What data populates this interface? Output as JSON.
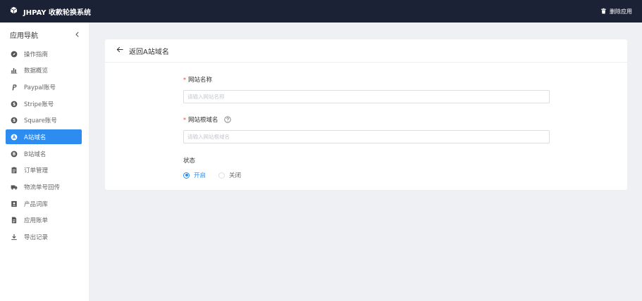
{
  "header": {
    "title": "JHPAY 收款轮换系统",
    "uninstall_label": "删除应用"
  },
  "sidebar": {
    "title": "应用导航",
    "items": [
      {
        "label": "操作指南",
        "icon": "compass-icon",
        "active": false
      },
      {
        "label": "数据概览",
        "icon": "bar-chart-icon",
        "active": false
      },
      {
        "label": "Paypal账号",
        "icon": "paypal-icon",
        "active": false
      },
      {
        "label": "Stripe账号",
        "icon": "dollar-circle-icon",
        "active": false
      },
      {
        "label": "Square账号",
        "icon": "dollar-circle-icon",
        "active": false
      },
      {
        "label": "A站域名",
        "icon": "letter-a-circle-icon",
        "active": true
      },
      {
        "label": "B站域名",
        "icon": "letter-b-circle-icon",
        "active": false
      },
      {
        "label": "订单管理",
        "icon": "clipboard-icon",
        "active": false
      },
      {
        "label": "物流单号回传",
        "icon": "truck-icon",
        "active": false
      },
      {
        "label": "产品词库",
        "icon": "contact-book-icon",
        "active": false
      },
      {
        "label": "应用账单",
        "icon": "document-icon",
        "active": false
      },
      {
        "label": "导出记录",
        "icon": "download-icon",
        "active": false
      }
    ]
  },
  "card": {
    "back_label": "返回A站域名"
  },
  "form": {
    "required_mark": "*",
    "site_name": {
      "label": "网站名称",
      "placeholder": "请输入网站名称",
      "value": ""
    },
    "root_domain": {
      "label": "网站根域名",
      "placeholder": "请输入网站根域名",
      "value": ""
    },
    "status": {
      "label": "状态",
      "options": [
        "开启",
        "关闭"
      ],
      "selected": "开启"
    }
  },
  "colors": {
    "topbar": "#1b2235",
    "accent": "#2d8cf0",
    "required": "#ed4014",
    "background": "#eef0f3"
  }
}
